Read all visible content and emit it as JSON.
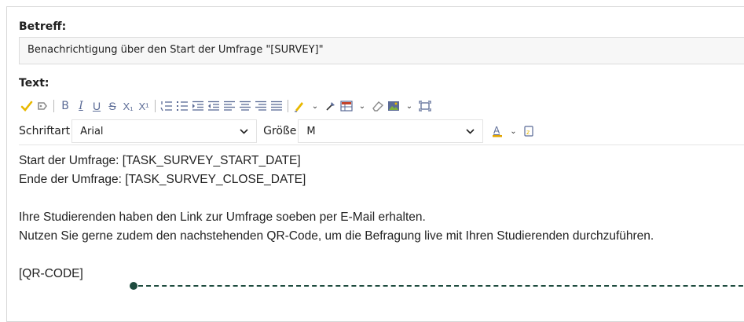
{
  "form": {
    "subject_label": "Betreff:",
    "subject_value": "Benachrichtigung über den Start der Umfrage \"[SURVEY]\"",
    "text_label": "Text:"
  },
  "toolbar": {
    "font_label": "Schriftart",
    "font_value": "Arial",
    "size_label": "Größe",
    "size_value": "M",
    "bold": "B",
    "italic": "I",
    "underline": "U",
    "strike": "S",
    "subscript": "X₁",
    "superscript": "X¹",
    "chevron": "⌄"
  },
  "editor": {
    "lines": [
      "Start der Umfrage: [TASK_SURVEY_START_DATE]",
      "Ende der Umfrage: [TASK_SURVEY_CLOSE_DATE]",
      "",
      "Ihre Studierenden haben den Link zur Umfrage soeben per E-Mail erhalten.",
      "Nutzen Sie gerne zudem den nachstehenden QR-Code, um die Befragung live mit Ihren Studierenden durchzuführen.",
      "",
      "[QR-CODE]"
    ]
  },
  "colors": {
    "icon_blue": "#5b6b96",
    "annotation": "#1e4b3e",
    "highlight_yellow": "#e8b800",
    "font_color_a": "#e2a400"
  }
}
